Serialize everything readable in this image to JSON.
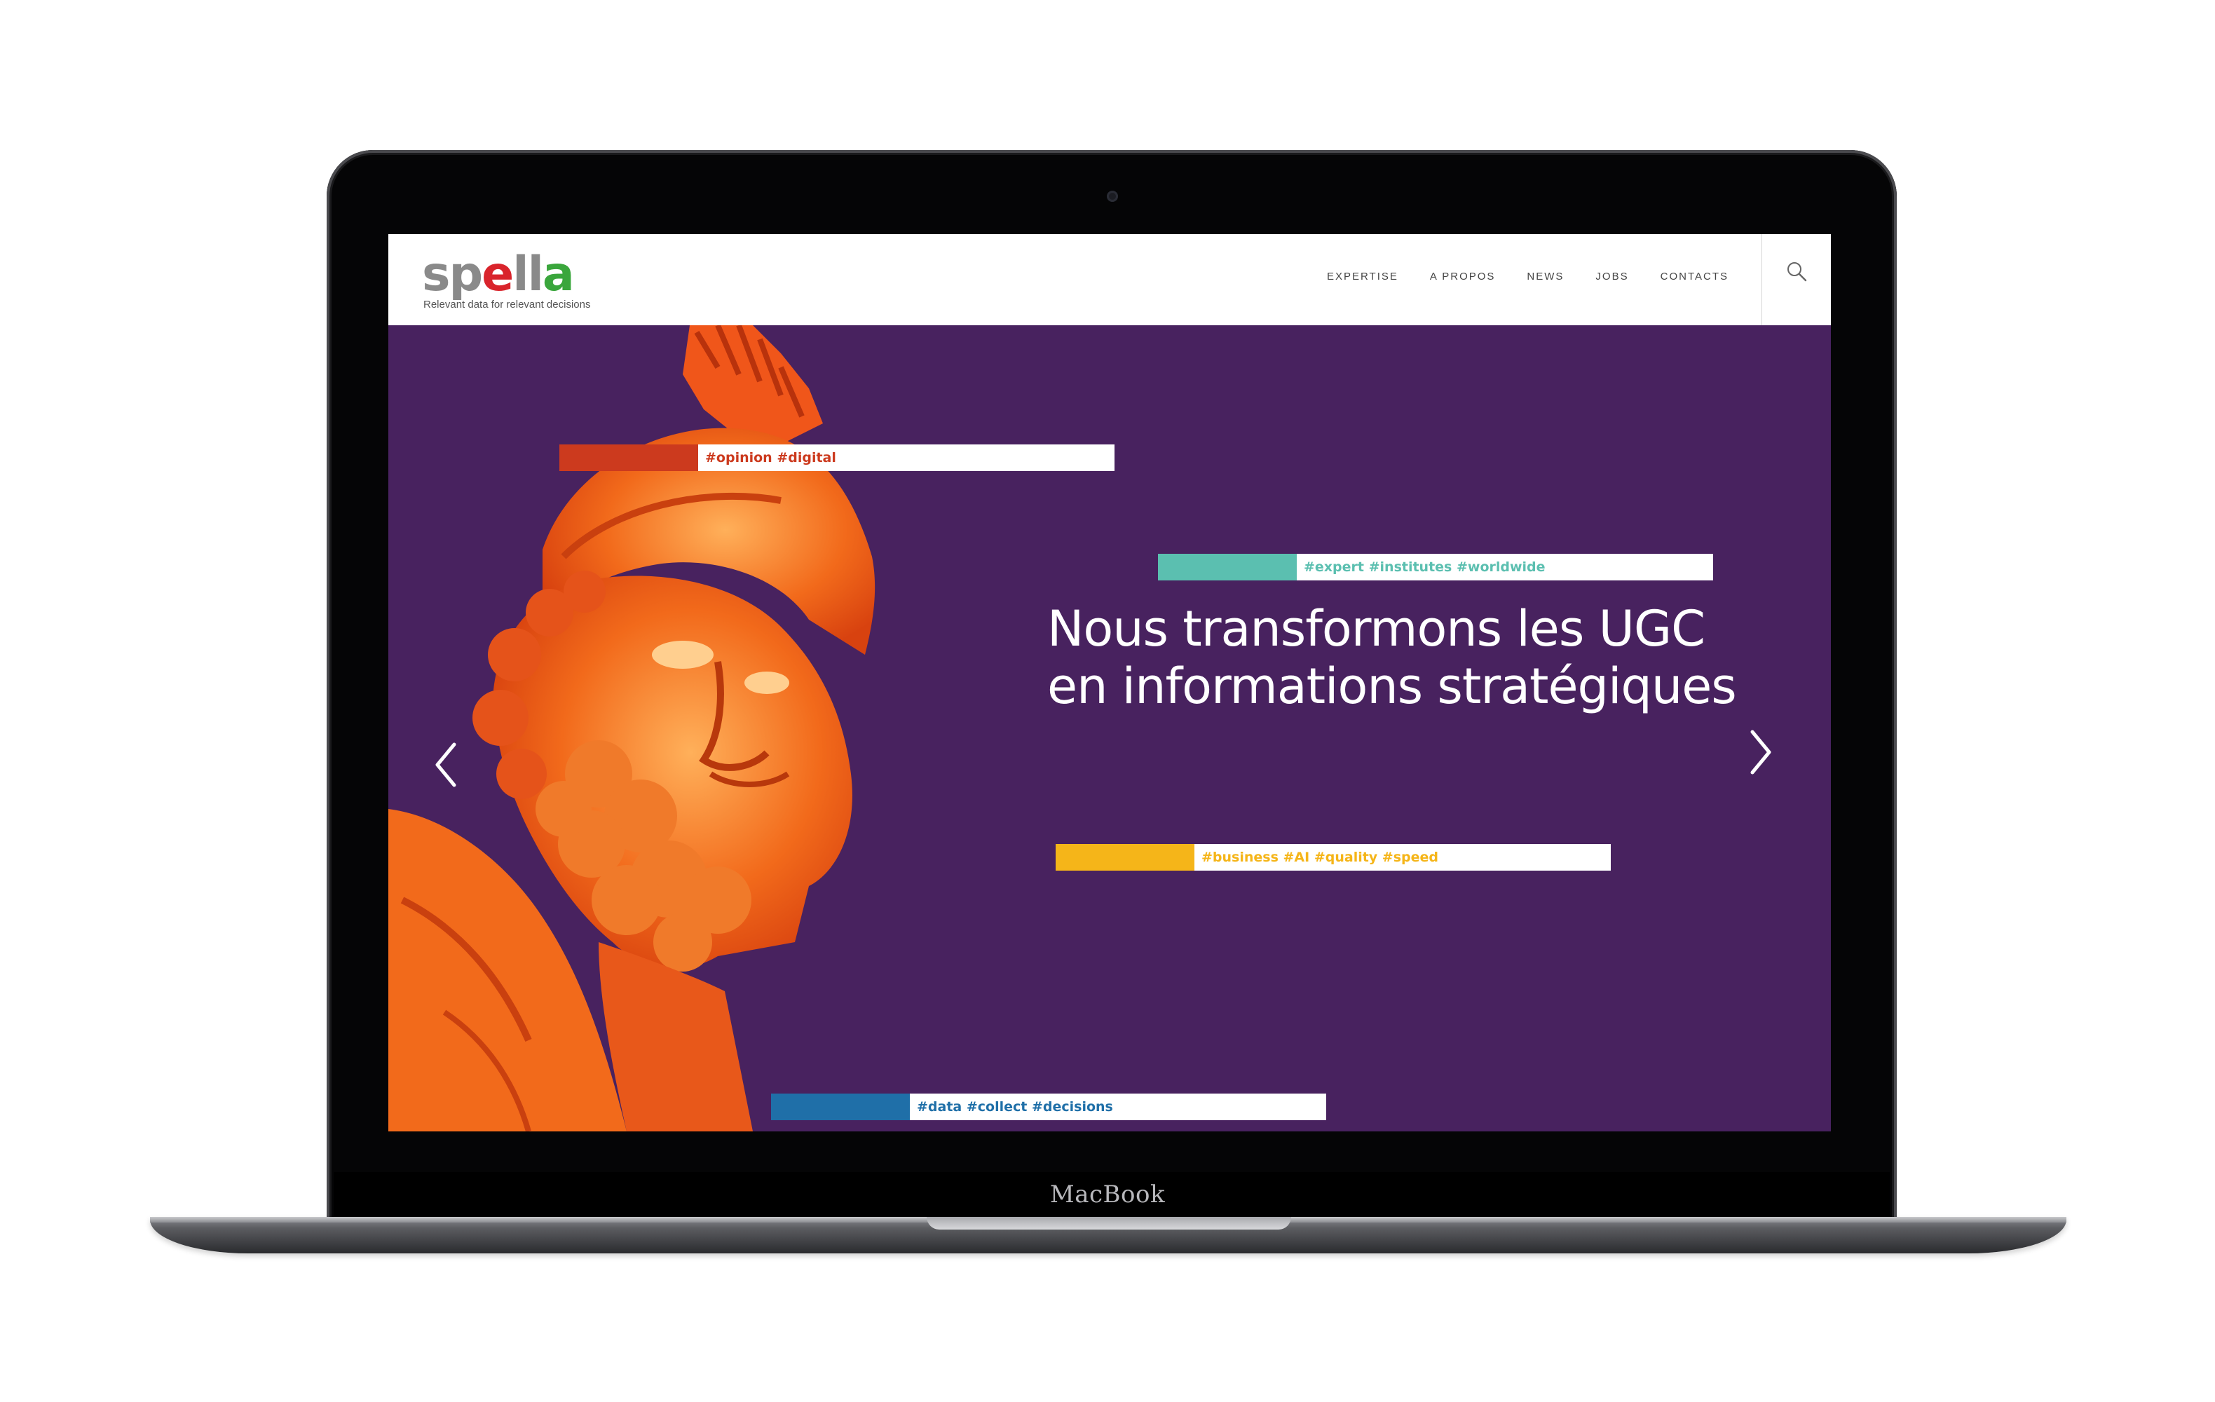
{
  "device": {
    "label": "MacBook"
  },
  "site": {
    "logo": {
      "part1": "sp",
      "part2": "e",
      "part3": "ll",
      "part4": "a"
    },
    "tagline": "Relevant data for relevant decisions",
    "nav": [
      "EXPERTISE",
      "A PROPOS",
      "NEWS",
      "JOBS",
      "CONTACTS"
    ],
    "search_icon": "search-icon"
  },
  "hero": {
    "background": "#48225f",
    "headline_line1": "Nous transformons les UGC",
    "headline_line2": "en informations stratégiques",
    "tags": [
      {
        "text": "#opinion #digital",
        "color": "#cc3a1e"
      },
      {
        "text": "#expert #institutes #worldwide",
        "color": "#5bbfb0"
      },
      {
        "text": "#business #AI #quality #speed",
        "color": "#f5b519"
      },
      {
        "text": "#data #collect #decisions",
        "color": "#1f6fa8"
      }
    ],
    "prev_icon": "chevron-left-icon",
    "next_icon": "chevron-right-icon"
  }
}
